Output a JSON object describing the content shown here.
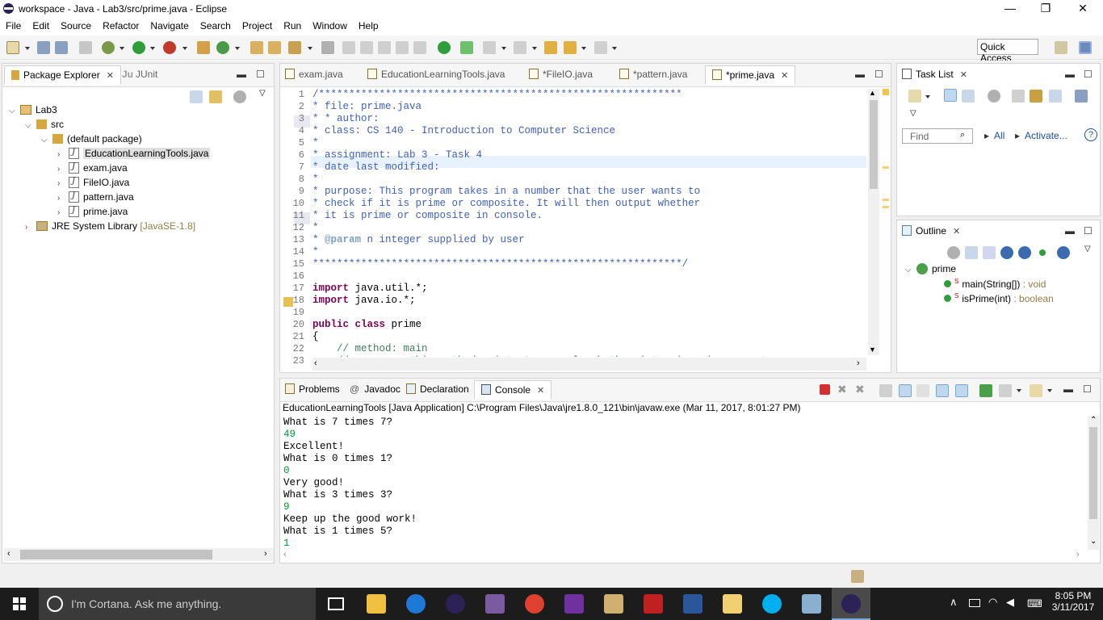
{
  "window": {
    "title": "workspace - Java - Lab3/src/prime.java - Eclipse",
    "min_glyph": "—",
    "max_glyph": "❐",
    "close_glyph": "✕"
  },
  "menu": [
    "File",
    "Edit",
    "Source",
    "Refactor",
    "Navigate",
    "Search",
    "Project",
    "Run",
    "Window",
    "Help"
  ],
  "toolbar": {
    "quick_access": "Quick Access"
  },
  "package_explorer": {
    "tab_label": "Package Explorer",
    "junit_tab": "JUnit",
    "tree": {
      "project": "Lab3",
      "src": "src",
      "package": "(default package)",
      "files": [
        "EducationLearningTools.java",
        "exam.java",
        "FileIO.java",
        "pattern.java",
        "prime.java"
      ],
      "jre": "JRE System Library",
      "jre_version": "[JavaSE-1.8]"
    }
  },
  "editor": {
    "tabs": [
      "exam.java",
      "EducationLearningTools.java",
      "*FileIO.java",
      "*pattern.java",
      "*prime.java"
    ],
    "active_tab": "*prime.java",
    "line_numbers": [
      "1",
      "2",
      "3",
      "4",
      "5",
      "6",
      "7",
      "8",
      "9",
      "10",
      "11",
      "12",
      "13",
      "14",
      "15",
      "16",
      "17",
      "18",
      "19",
      "20",
      "21",
      "22",
      "23"
    ],
    "lines": [
      "/************************************************************",
      "* file: prime.java",
      "* * author:",
      "* class: CS 140 - Introduction to Computer Science",
      "*",
      "* assignment: Lab 3 - Task 4",
      "* date last modified:",
      "*",
      "* purpose: This program takes in a number that the user wants to",
      "* check if it is prime or composite. It will then output whether",
      "* it is prime or composite in console.",
      "*",
      "* @param n integer supplied by user",
      "*",
      "*************************************************************/",
      "",
      "import java.util.*;",
      "import java.io.*;",
      "",
      "public class prime",
      "{",
      "    // method: main",
      "    // purpose: this method prints to console whether int n is prime or not"
    ]
  },
  "task_list": {
    "tab_label": "Task List",
    "find_placeholder": "Find",
    "all_label": "All",
    "activate_label": "Activate..."
  },
  "outline": {
    "tab_label": "Outline",
    "class_name": "prime",
    "members": [
      {
        "name": "main(String[])",
        "type": ": void"
      },
      {
        "name": "isPrime(int)",
        "type": ": boolean"
      }
    ]
  },
  "bottom_panel": {
    "tabs": [
      "Problems",
      "Javadoc",
      "Declaration",
      "Console"
    ],
    "active_tab": "Console",
    "console_header": "EducationLearningTools [Java Application] C:\\Program Files\\Java\\jre1.8.0_121\\bin\\javaw.exe (Mar 11, 2017, 8:01:27 PM)",
    "console_lines": [
      {
        "text": "What is 7 times 7?",
        "input": false
      },
      {
        "text": "49",
        "input": true
      },
      {
        "text": "Excellent!",
        "input": false
      },
      {
        "text": "What is 0 times 1?",
        "input": false
      },
      {
        "text": "0",
        "input": true
      },
      {
        "text": "Very good!",
        "input": false
      },
      {
        "text": "What is 3 times 3?",
        "input": false
      },
      {
        "text": "9",
        "input": true
      },
      {
        "text": "Keep up the good work!",
        "input": false
      },
      {
        "text": "What is 1 times 5?",
        "input": false
      },
      {
        "text": "1",
        "input": true
      }
    ]
  },
  "taskbar": {
    "search_placeholder": "I'm Cortana. Ask me anything.",
    "time": "8:05 PM",
    "date": "3/11/2017"
  },
  "colors": {
    "comment": "#3f5fbf",
    "keyword": "#7f0055",
    "console_input": "#009a3a",
    "taskbar": "#1c1c1c"
  }
}
